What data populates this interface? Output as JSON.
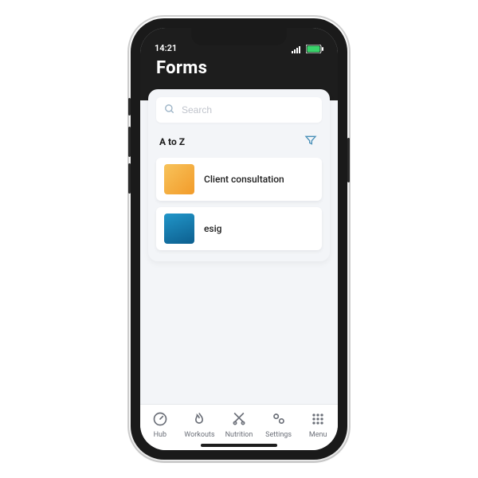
{
  "status": {
    "time": "14:21"
  },
  "header": {
    "title": "Forms"
  },
  "search": {
    "placeholder": "Search"
  },
  "section": {
    "heading": "A to Z"
  },
  "forms": [
    {
      "title": "Client consultation",
      "thumb": "orange"
    },
    {
      "title": "esig",
      "thumb": "blue"
    }
  ],
  "tabs": [
    {
      "label": "Hub"
    },
    {
      "label": "Workouts"
    },
    {
      "label": "Nutrition"
    },
    {
      "label": "Settings"
    },
    {
      "label": "Menu"
    }
  ]
}
